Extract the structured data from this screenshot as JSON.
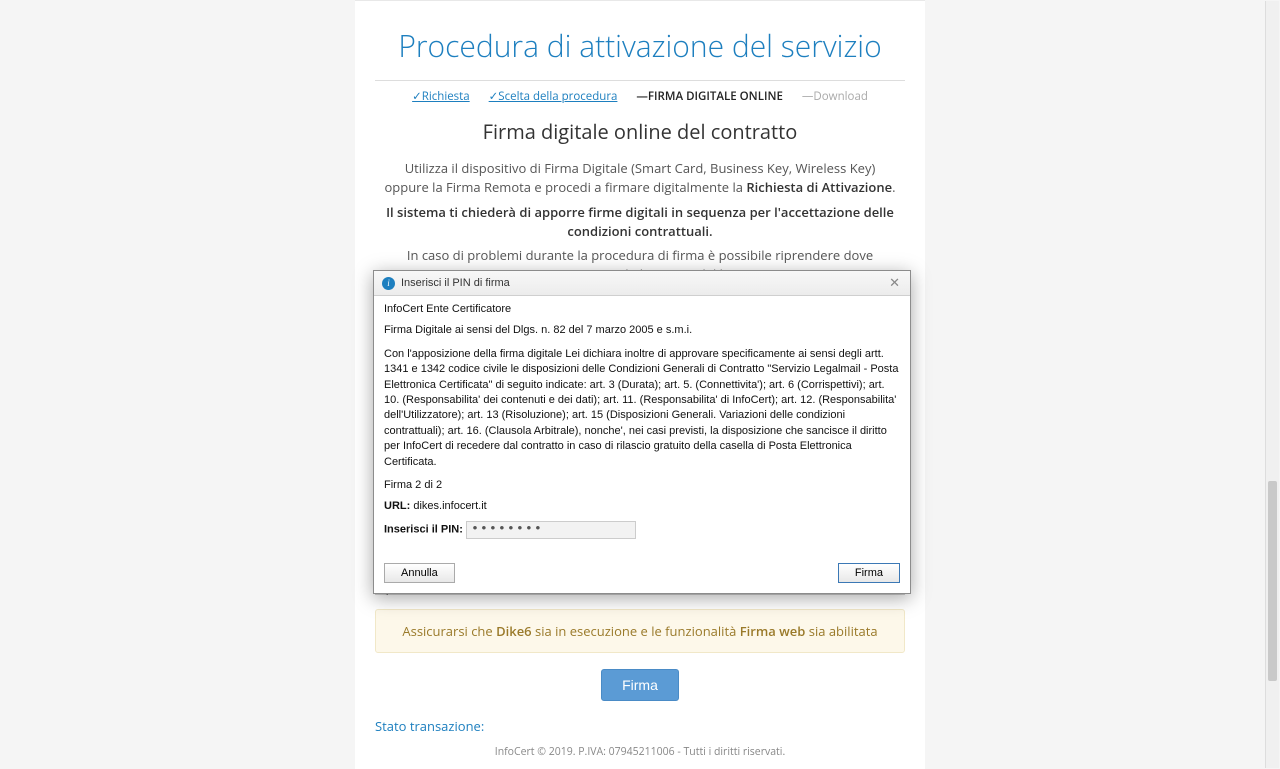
{
  "page": {
    "title": "Procedura di attivazione del servizio",
    "subheading": "Firma digitale online del contratto"
  },
  "steps": {
    "s1": "✓Richiesta",
    "s2": "✓Scelta della procedura",
    "s3_prefix": "—",
    "s3": "FIRMA DIGITALE ONLINE",
    "s4_prefix": "—",
    "s4": "Download"
  },
  "body": {
    "p1a": "Utilizza il dispositivo di Firma Digitale (Smart Card, Business Key, Wireless Key) oppure la Firma Remota e procedi a firmare digitalmente la ",
    "p1b": "Richiesta di Attivazione",
    "p1c": ".",
    "p2": "Il sistema ti chiederà di apporre firme digitali in sequenza per l'accettazione delle condizioni contrattuali.",
    "p3": "In caso di problemi durante la procedura di firma è possibile riprendere dove interrotta ricaricando la pagina del browser."
  },
  "alert": {
    "a": "Assicurarsi che ",
    "b": "Dike6",
    "c": " sia in esecuzione e le funzionalità ",
    "d": "Firma web",
    "e": " sia abilitata"
  },
  "actions": {
    "firma": "Firma"
  },
  "status": {
    "label": "Stato transazione:"
  },
  "footer": {
    "text": "InfoCert © 2019. P.IVA: 07945211006 - Tutti i diritti riservati."
  },
  "dialog": {
    "title": "Inserisci il PIN di firma",
    "ente": "InfoCert Ente Certificatore",
    "law": "Firma Digitale ai sensi del Dlgs. n. 82 del 7 marzo 2005 e s.m.i.",
    "clause": "Con l'apposizione della firma digitale Lei dichiara inoltre di approvare specificamente ai sensi degli artt. 1341 e 1342 codice civile le disposizioni delle Condizioni Generali di Contratto \"Servizio Legalmail - Posta Elettronica Certificata\" di seguito indicate: art. 3 (Durata); art. 5. (Connettivita'); art. 6 (Corrispettivi); art. 10. (Responsabilita' dei contenuti e dei dati); art. 11. (Responsabilita' di InfoCert); art. 12. (Responsabilita' dell'Utilizzatore); art. 13 (Risoluzione); art. 15 (Disposizioni Generali. Variazioni delle condizioni contrattuali); art. 16. (Clausola Arbitrale), nonche', nei casi previsti, la disposizione che sancisce il diritto per InfoCert di recedere dal contratto in caso di rilascio gratuito della casella di Posta Elettronica Certificata.",
    "progress": "Firma  2  di  2",
    "url_label": "URL:",
    "url_value": "dikes.infocert.it",
    "pin_label": "Inserisci il PIN:",
    "pin_mask": "••••••••",
    "cancel": "Annulla",
    "ok": "Firma"
  }
}
